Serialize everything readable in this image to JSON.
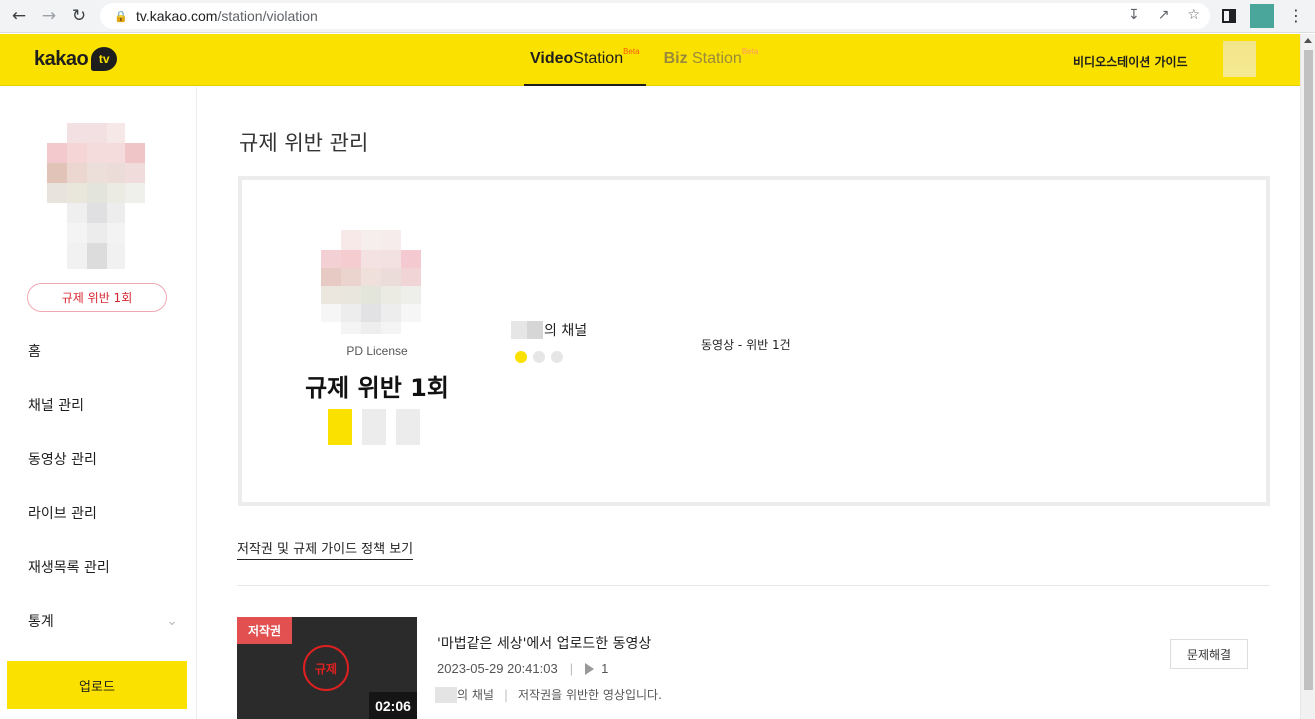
{
  "browser": {
    "url_host": "tv.kakao.com",
    "url_path": "/station/violation"
  },
  "header": {
    "logo_text": "kakao",
    "logo_tv": "tv",
    "tabs": [
      {
        "bold": "Video",
        "rest": "Station",
        "beta": "Beta",
        "active": true
      },
      {
        "bold": "Biz",
        "rest": " Station",
        "beta": "Beta",
        "active": false
      }
    ],
    "guide_link": "비디오스테이션 가이드"
  },
  "sidebar": {
    "violation_badge": "규제 위반 1회",
    "menu": [
      {
        "label": "홈"
      },
      {
        "label": "채널 관리"
      },
      {
        "label": "동영상 관리"
      },
      {
        "label": "라이브 관리"
      },
      {
        "label": "재생목록 관리"
      },
      {
        "label": "통계",
        "expandable": true
      }
    ],
    "upload_label": "업로드"
  },
  "main": {
    "page_title": "규제 위반 관리",
    "summary": {
      "license_label": "PD License",
      "violation_count_text": "규제 위반 1회",
      "license_bars": {
        "filled": 1,
        "total": 3
      },
      "channel_suffix": "의 채널",
      "channel_dots": {
        "active": 1,
        "total": 3
      },
      "video_violation": "동영상 - 위반 1건"
    },
    "policy_link": "저작권 및 규제 가이드 정책 보기",
    "violations": [
      {
        "tag": "저작권",
        "stamp": "규제",
        "duration": "02:06",
        "title": "'마법같은 세상'에서 업로드한 동영상",
        "datetime": "2023-05-29 20:41:03",
        "views": "1",
        "channel_suffix": "의 채널",
        "reason": "저작권을 위반한 영상입니다.",
        "action_label": "문제해결"
      }
    ]
  }
}
